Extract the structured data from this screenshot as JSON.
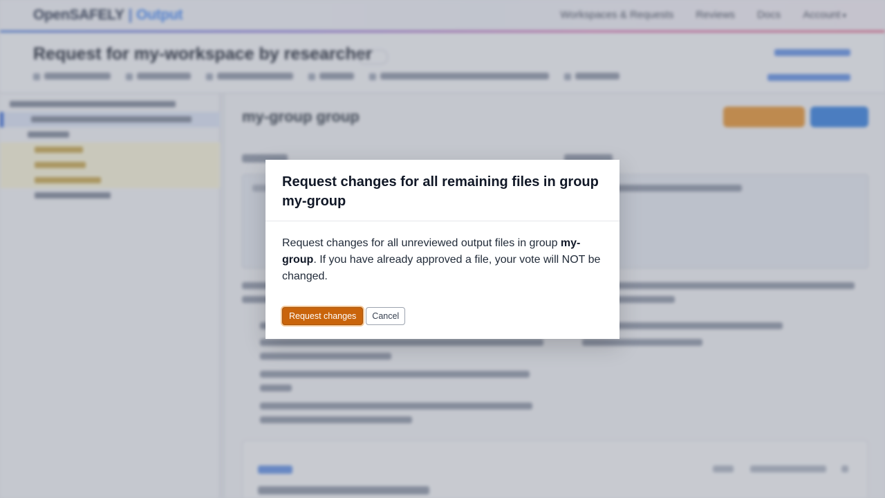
{
  "app": {
    "brand": "OpenSAFELY",
    "brand_sub": "Output"
  },
  "nav": {
    "items": [
      "Workspaces & Requests",
      "Reviews",
      "Docs",
      "Account"
    ]
  },
  "background": {
    "page_title": "Request for my-workspace by researcher",
    "section_title": "my-group group"
  },
  "modal": {
    "title": "Request changes for all remaining files in group my-group",
    "body_prefix": "Request changes for all unreviewed output files in group ",
    "body_group": "my-group",
    "body_suffix": ". If you have already approved a file, your vote will NOT be changed.",
    "primary_label": "Request changes",
    "cancel_label": "Cancel"
  },
  "colors": {
    "primary_button": "#c9640b",
    "accent_blue": "#2d63d8"
  }
}
